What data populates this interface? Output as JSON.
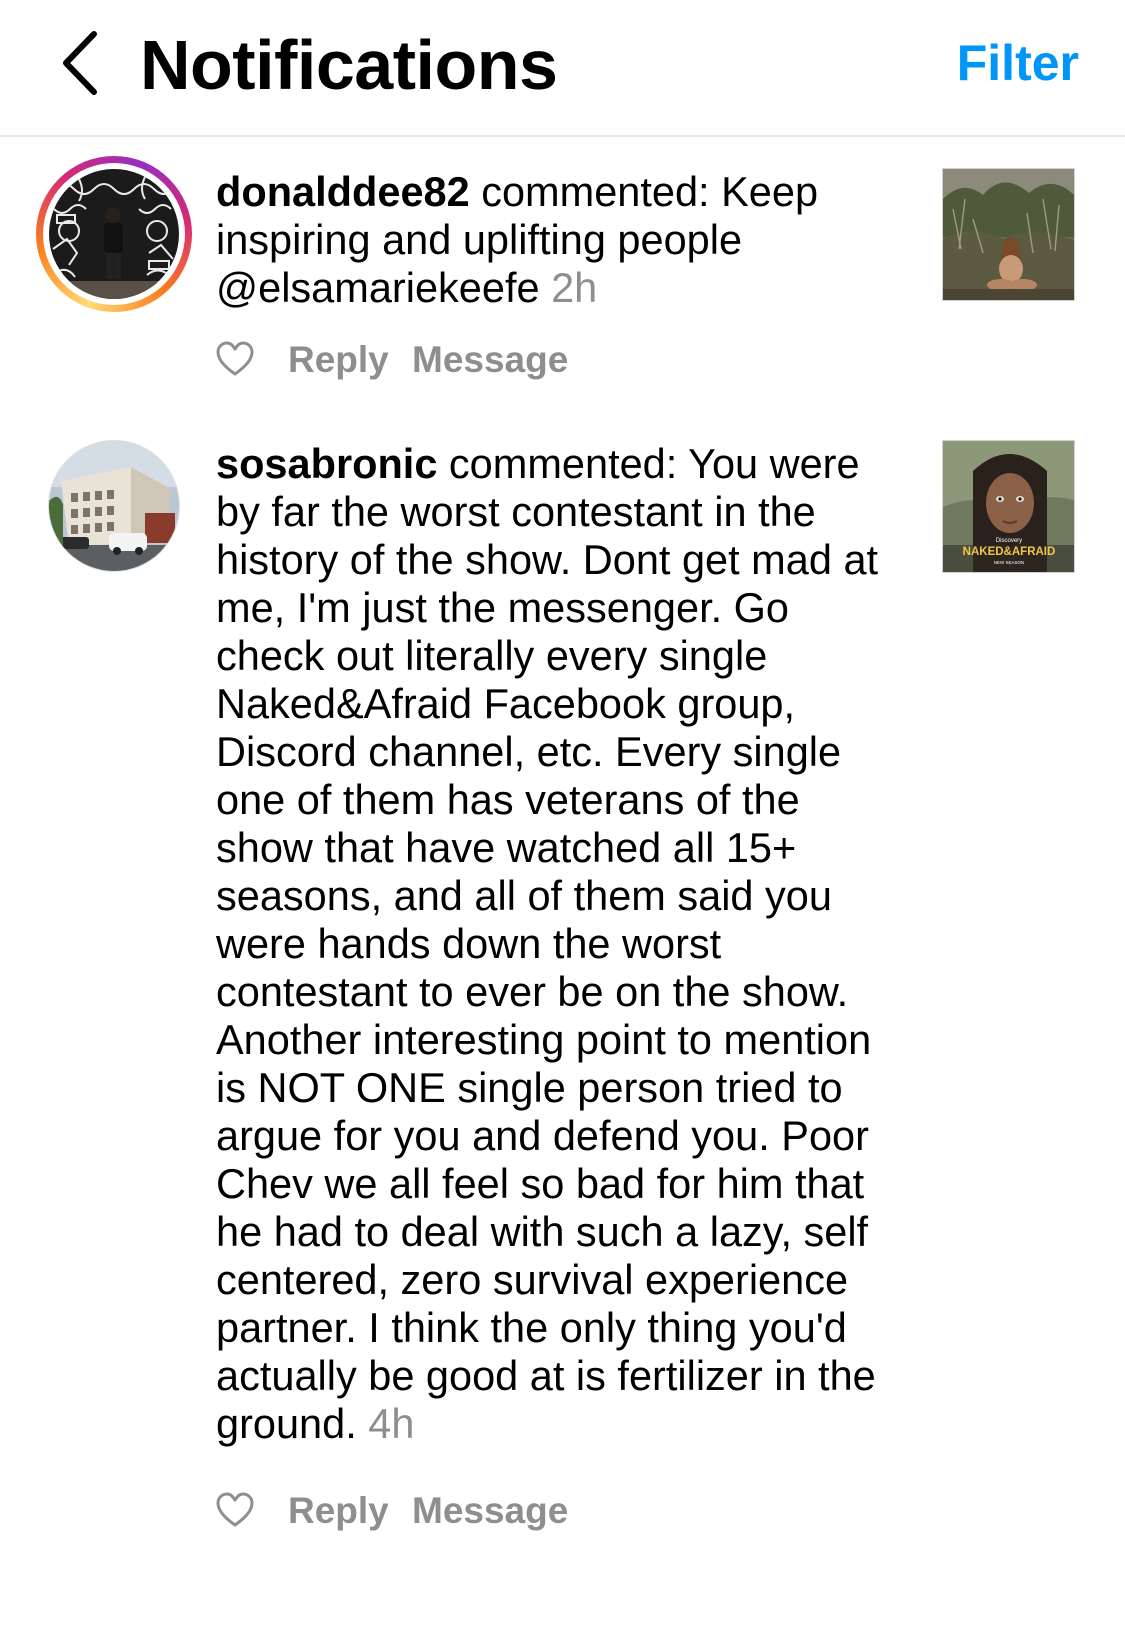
{
  "header": {
    "back_icon": "chevron-left-icon",
    "title": "Notifications",
    "filter_label": "Filter",
    "accent_color": "#0095f6"
  },
  "notifications": [
    {
      "username": "donalddee82",
      "body": " commented: Keep inspiring and uplifting people @elsamariekeefe ",
      "time": "2h",
      "has_story_ring": true,
      "reply_label": "Reply",
      "message_label": "Message",
      "like_icon": "heart-outline-icon"
    },
    {
      "username": "sosabronic",
      "body": " commented: You were by far the worst contestant in the history of the show. Dont get mad at me,  I'm just the messenger. Go check out literally every single Naked&Afraid Facebook group, Discord channel, etc. Every single one of them has veterans of the show that have watched all 15+ seasons, and all of them said you were hands down the worst contestant to ever be on the show. Another interesting point to mention is NOT ONE single person tried to argue for you and defend you. Poor Chev we all feel so bad for him that he had to deal with such a lazy, self centered, zero survival experience partner. I think the only thing you'd actually be good at is fertilizer in the ground. ",
      "time": "4h",
      "has_story_ring": false,
      "reply_label": "Reply",
      "message_label": "Message",
      "like_icon": "heart-outline-icon",
      "thumb_text": {
        "network": "Discovery",
        "show": "NAKED&AFRAID",
        "tagline": "NEW SEASON"
      }
    }
  ]
}
